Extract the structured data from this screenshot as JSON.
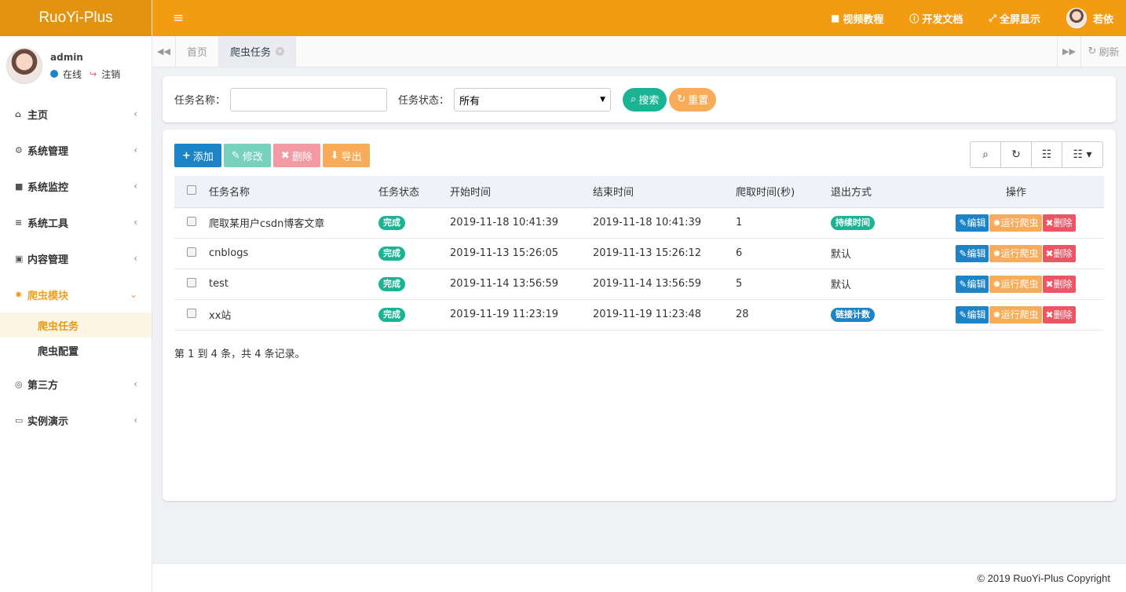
{
  "brand": "RuoYi-Plus",
  "user": {
    "name": "admin",
    "status": "在线",
    "logout": "注销"
  },
  "menu": {
    "home": "主页",
    "system": "系统管理",
    "monitor": "系统监控",
    "tools": "系统工具",
    "content": "内容管理",
    "crawler": "爬虫模块",
    "crawler_task": "爬虫任务",
    "crawler_config": "爬虫配置",
    "third": "第三方",
    "demo": "实例演示"
  },
  "topbar": {
    "video": "视频教程",
    "docs": "开发文档",
    "fullscreen": "全屏显示",
    "user": "若依"
  },
  "tabs": {
    "home": "首页",
    "active": "爬虫任务",
    "refresh": "刷新"
  },
  "search": {
    "name_label": "任务名称：",
    "status_label": "任务状态：",
    "status_value": "所有",
    "search_btn": "搜索",
    "reset_btn": "重置"
  },
  "toolbar": {
    "add": "添加",
    "edit": "修改",
    "delete": "删除",
    "export": "导出"
  },
  "table": {
    "headers": [
      "任务名称",
      "任务状态",
      "开始时间",
      "结束时间",
      "爬取时间(秒)",
      "退出方式",
      "操作"
    ],
    "rows": [
      {
        "name": "爬取某用户csdn博客文章",
        "status": "完成",
        "start": "2019-11-18 10:41:39",
        "end": "2019-11-18 10:41:39",
        "duration": "1",
        "exit": "持续时间",
        "exit_badge": true,
        "exit_color": "#1ab394"
      },
      {
        "name": "cnblogs",
        "status": "完成",
        "start": "2019-11-13 15:26:05",
        "end": "2019-11-13 15:26:12",
        "duration": "6",
        "exit": "默认",
        "exit_badge": false
      },
      {
        "name": "test",
        "status": "完成",
        "start": "2019-11-14 13:56:59",
        "end": "2019-11-14 13:56:59",
        "duration": "5",
        "exit": "默认",
        "exit_badge": false
      },
      {
        "name": "xx站",
        "status": "完成",
        "start": "2019-11-19 11:23:19",
        "end": "2019-11-19 11:23:48",
        "duration": "28",
        "exit": "链接计数",
        "exit_badge": true,
        "exit_color": "#1c84c6"
      }
    ],
    "ops": {
      "edit": "编辑",
      "run": "运行爬虫",
      "delete": "删除"
    }
  },
  "pager": "第 1 到 4 条，共 4 条记录。",
  "footer": "© 2019 RuoYi-Plus Copyright",
  "colors": {
    "header": "#f39c12",
    "brand_bg": "#e2930f",
    "primary": "#1c84c6",
    "success": "#1ab394",
    "warning": "#f8ac59",
    "danger": "#ed5565"
  }
}
